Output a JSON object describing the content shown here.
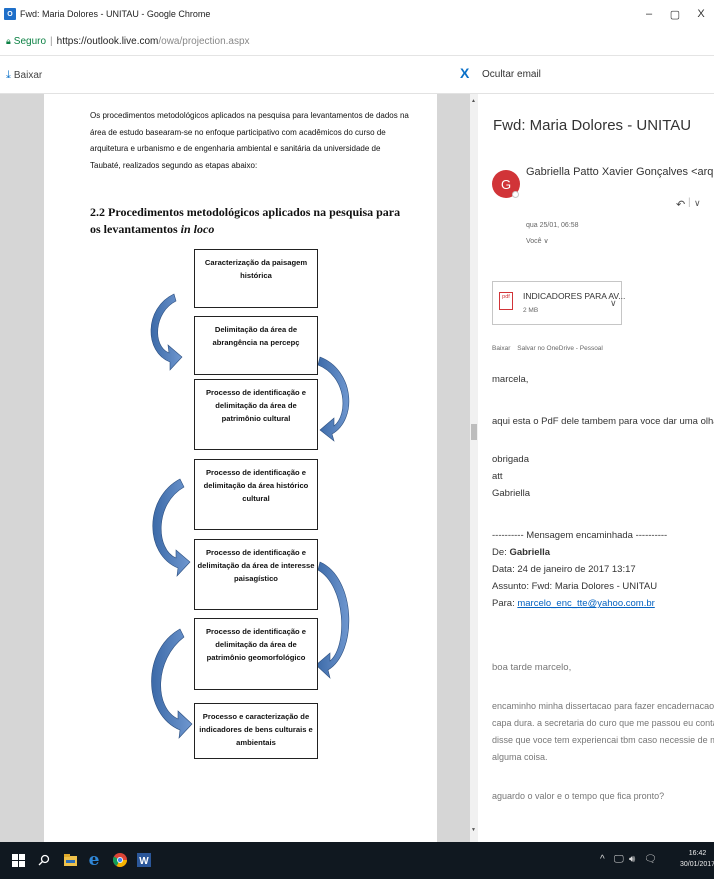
{
  "window": {
    "app_icon": "O",
    "title": "Fwd: Maria Dolores - UNITAU - Google Chrome",
    "minimize": "–",
    "maximize": "▢",
    "close": "X"
  },
  "address_bar": {
    "secure_label": "Seguro",
    "url_host": "https://outlook.live.com",
    "url_path": "/owa/projection.aspx"
  },
  "toolbar": {
    "download_label": "Baixar",
    "close_label": "X",
    "hide_email_label": "Ocultar email"
  },
  "document": {
    "intro": "Os procedimentos metodológicos aplicados na pesquisa para levantamentos de dados na área de estudo basearam-se no enfoque participativo com acadêmicos do curso de arquitetura e urbanismo e de engenharia ambiental e sanitária da universidade de Taubaté, realizados segundo as etapas abaixo:",
    "heading_prefix": "2.2 Procedimentos metodológicos aplicados na pesquisa para os levantamentos ",
    "heading_italic": "in loco",
    "flow_steps": [
      "Caracterização da paisagem histórica",
      "Delimitação da área de abrangência na percepç",
      "Processo de identificação e delimitação da área de patrimônio cultural",
      "Processo de identificação e delimitação da área histórico cultural",
      "Processo de identificação e delimitação da área de interesse paisagístico",
      "Processo de identificação e delimitação da área de patrimônio geomorfológico",
      "Processo e caracterização de indicadores de bens culturais e ambientais"
    ]
  },
  "email": {
    "subject": "Fwd: Maria Dolores - UNITAU",
    "avatar_letter": "G",
    "sender": "Gabriella Patto Xavier Gonçalves <arq.gpatto@gm",
    "reply_icon": "reply-icon",
    "date": "qua 25/01, 06:58",
    "to": "Você ∨",
    "attachment": {
      "icon_text": "pdf",
      "name": "INDICADORES PARA AV...",
      "size": "2 MB",
      "actions": [
        "Baixar",
        "Salvar no OneDrive - Pessoal"
      ]
    },
    "body": {
      "greeting": "marcela,",
      "line1": "aqui esta o PdF dele tambem para voce dar uma olhada ..",
      "sign1": "obrigada",
      "sign2": "att",
      "sign3": "Gabriella",
      "fwd_header": "---------- Mensagem encaminhada ----------",
      "from_label": "De: ",
      "from_value": "Gabriella",
      "date_line": "Data: 24 de janeiro de 2017 13:17",
      "subject_line": "Assunto: Fwd: Maria Dolores - UNITAU",
      "to_label": "Para: ",
      "to_email": "marcelo_enc_tte@yahoo.com.br",
      "quoted_greeting": "boa tarde marcelo,",
      "quoted_1": "encaminho minha dissertacao para fazer encadernacao final com",
      "quoted_2": "capa dura. a secretaria do curo que me passou eu contato e",
      "quoted_3": "disse que voce tem experiencai tbm caso necessie de mais",
      "quoted_4": "alguma coisa.",
      "quoted_5": "aguardo o valor e o tempo que fica pronto?"
    }
  },
  "taskbar": {
    "time": "16:42",
    "date": "30/01/2017",
    "tray_chevron": "^"
  }
}
